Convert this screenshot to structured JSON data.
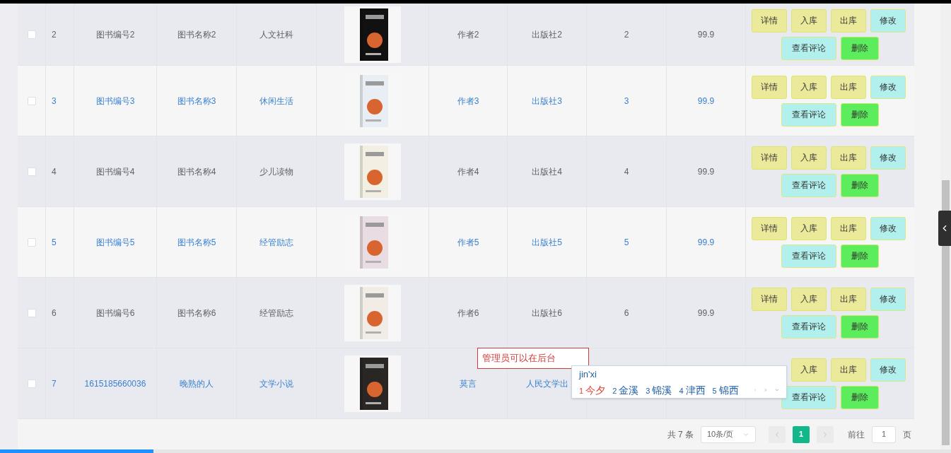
{
  "rows": [
    {
      "id": "2",
      "code": "图书编号2",
      "name": "图书名称2",
      "category": "人文社科",
      "author": "作者2",
      "publisher": "出版社2",
      "stock": "2",
      "price": "99.9",
      "checked": false,
      "linked": false,
      "shaded": true,
      "actions": [
        {
          "label": "详情",
          "kind": "yellow"
        },
        {
          "label": "入库",
          "kind": "yellow"
        },
        {
          "label": "出库",
          "kind": "yellow"
        },
        {
          "label": "修改",
          "kind": "cyan"
        },
        {
          "label": "查看评论",
          "kind": "cyan"
        },
        {
          "label": "删除",
          "kind": "green"
        }
      ]
    },
    {
      "id": "3",
      "code": "图书编号3",
      "name": "图书名称3",
      "category": "休闲生活",
      "author": "作者3",
      "publisher": "出版社3",
      "stock": "3",
      "price": "99.9",
      "checked": false,
      "linked": true,
      "shaded": false,
      "actions": [
        {
          "label": "详情",
          "kind": "yellow"
        },
        {
          "label": "入库",
          "kind": "yellow"
        },
        {
          "label": "出库",
          "kind": "yellow"
        },
        {
          "label": "修改",
          "kind": "cyan"
        },
        {
          "label": "查看评论",
          "kind": "cyan"
        },
        {
          "label": "删除",
          "kind": "green"
        }
      ]
    },
    {
      "id": "4",
      "code": "图书编号4",
      "name": "图书名称4",
      "category": "少儿读物",
      "author": "作者4",
      "publisher": "出版社4",
      "stock": "4",
      "price": "99.9",
      "checked": false,
      "linked": false,
      "shaded": true,
      "actions": [
        {
          "label": "详情",
          "kind": "yellow"
        },
        {
          "label": "入库",
          "kind": "yellow"
        },
        {
          "label": "出库",
          "kind": "yellow"
        },
        {
          "label": "修改",
          "kind": "cyan"
        },
        {
          "label": "查看评论",
          "kind": "cyan"
        },
        {
          "label": "删除",
          "kind": "green"
        }
      ]
    },
    {
      "id": "5",
      "code": "图书编号5",
      "name": "图书名称5",
      "category": "经管励志",
      "author": "作者5",
      "publisher": "出版社5",
      "stock": "5",
      "price": "99.9",
      "checked": false,
      "linked": true,
      "shaded": false,
      "actions": [
        {
          "label": "详情",
          "kind": "yellow"
        },
        {
          "label": "入库",
          "kind": "yellow"
        },
        {
          "label": "出库",
          "kind": "yellow"
        },
        {
          "label": "修改",
          "kind": "cyan"
        },
        {
          "label": "查看评论",
          "kind": "cyan"
        },
        {
          "label": "删除",
          "kind": "green"
        }
      ]
    },
    {
      "id": "6",
      "code": "图书编号6",
      "name": "图书名称6",
      "category": "经管励志",
      "author": "作者6",
      "publisher": "出版社6",
      "stock": "6",
      "price": "99.9",
      "checked": false,
      "linked": false,
      "shaded": true,
      "actions": [
        {
          "label": "详情",
          "kind": "yellow"
        },
        {
          "label": "入库",
          "kind": "yellow"
        },
        {
          "label": "出库",
          "kind": "yellow"
        },
        {
          "label": "修改",
          "kind": "cyan"
        },
        {
          "label": "查看评论",
          "kind": "cyan"
        },
        {
          "label": "删除",
          "kind": "green"
        }
      ]
    },
    {
      "id": "7",
      "code": "1615185660036",
      "name": "晚熟的人",
      "category": "文学小说",
      "author": "莫言",
      "publisher": "人民文学出",
      "stock": "",
      "price": "",
      "checked": false,
      "linked": true,
      "shaded": true,
      "actions": [
        {
          "label": "入库",
          "kind": "yellow"
        },
        {
          "label": "出库",
          "kind": "yellow"
        },
        {
          "label": "修改",
          "kind": "cyan"
        },
        {
          "label": "查看评论",
          "kind": "cyan"
        },
        {
          "label": "删除",
          "kind": "green"
        }
      ]
    }
  ],
  "tooltip": {
    "text": "管理员可以在后台"
  },
  "ime": {
    "input": "jin'xi",
    "candidates": [
      {
        "index": "1",
        "text": "今夕",
        "selected": true
      },
      {
        "index": "2",
        "text": "金溪",
        "selected": false
      },
      {
        "index": "3",
        "text": "锦溪",
        "selected": false
      },
      {
        "index": "4",
        "text": "津西",
        "selected": false
      },
      {
        "index": "5",
        "text": "锦西",
        "selected": false
      }
    ]
  },
  "pagination": {
    "total": "共 7 条",
    "page_size": "10条/页",
    "pages": [
      {
        "label": "1",
        "selected": true
      }
    ],
    "goto_label": "前往",
    "goto_value": "1",
    "goto_suffix": "页"
  }
}
